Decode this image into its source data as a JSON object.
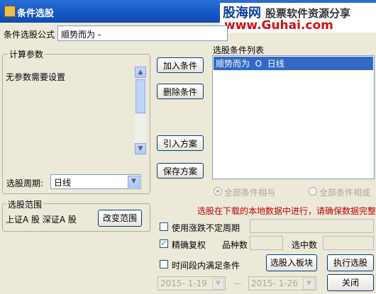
{
  "window": {
    "title": "条件选股"
  },
  "watermark": {
    "brand": "股海网",
    "slogan": "股票软件资源分享",
    "url": "www.Guhai.com"
  },
  "formula": {
    "label": "条件选股公式",
    "value": "顺势而为 -"
  },
  "params": {
    "group_label": "计算参数",
    "text": "无参数需要设置"
  },
  "period": {
    "label": "选股周期:",
    "value": "日线"
  },
  "range": {
    "group_label": "选股范围",
    "text": "上证A 股 深证A 股",
    "change_button": "改变范围"
  },
  "buttons": {
    "add": "加入条件",
    "delete": "删除条件",
    "import": "引入方案",
    "save": "保存方案",
    "to_board": "选股入板块",
    "execute": "执行选股",
    "close": "关闭"
  },
  "conditions": {
    "label": "选股条件列表",
    "items": [
      "顺势而为  O  日线"
    ]
  },
  "logic": {
    "and": "全部条件相与",
    "or": "全部条件相或"
  },
  "warning": "选股在下载的本地数据中进行，请确保数据完整",
  "options": {
    "variable_period": "使用涨跌不定周期",
    "precise_adjust": "精确复权",
    "time_range": "时间段内满足条件"
  },
  "stats": {
    "variety_label": "品种数",
    "selected_label": "选中数"
  },
  "dates": {
    "start": "2015- 1-19",
    "separator": "－",
    "end": "2015- 1-26"
  },
  "colors": {
    "title_bar": "#1556c4",
    "selection": "#316ac5",
    "warning": "#c00000"
  }
}
